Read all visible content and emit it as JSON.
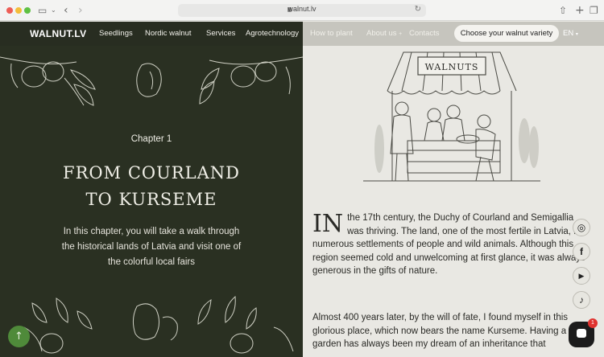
{
  "browser": {
    "url": "walnut.lv"
  },
  "nav": {
    "logo": "WALNUT.LV",
    "items": [
      "Seedlings",
      "Nordic walnut",
      "Services",
      "Agrotechnology",
      "How to plant",
      "About us",
      "Contacts"
    ],
    "about_suffix": "+",
    "cta": "Choose your walnut variety",
    "language": "EN"
  },
  "hero": {
    "chapter": "Chapter 1",
    "title_line1": "FROM COURLAND",
    "title_line2": "TO KURSEME",
    "lead": "In this chapter, you will take a walk through the historical lands of Latvia and visit one of the colorful local fairs"
  },
  "illustration": {
    "sign": "WALNUTS"
  },
  "article": {
    "dropcap": "IN",
    "p1": "the 17th century, the Duchy of Courland and Semigallia was thriving. The land, one of the most fertile in Latvia, fed numerous settlements of people and wild animals. Although this region seemed cold and unwelcoming at first glance, it was always generous in the gifts of nature.",
    "p2": "Almost 400 years later, by the will of fate, I found myself in this glorious place, which now bears the name Kurseme. Having a large garden has always been my dream of an inheritance that"
  },
  "chat": {
    "badge": "1"
  },
  "icons": [
    "sidebar-icon",
    "back-icon",
    "forward-icon",
    "lock-icon",
    "reload-icon",
    "share-icon",
    "new-tab-icon",
    "tabs-icon",
    "instagram-icon",
    "facebook-icon",
    "youtube-icon",
    "tiktok-icon",
    "arrow-up-icon",
    "chat-icon"
  ],
  "colors": {
    "dark_panel": "#2a3022",
    "light_bg": "#e9e8e3",
    "scroll_button": "#4f8a3a"
  }
}
